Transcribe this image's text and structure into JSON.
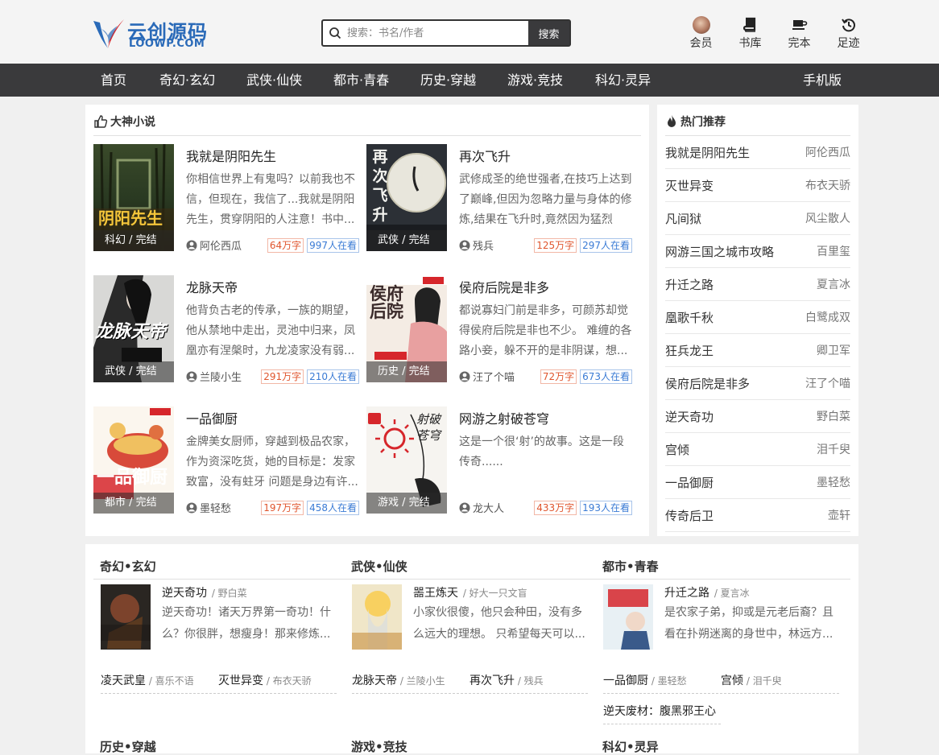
{
  "header": {
    "logo_name": "云创源码",
    "logo_domain": "LOOWP.COM",
    "search_placeholder": "搜索：书名/作者",
    "search_button": "搜索",
    "user_nav": [
      {
        "label": "会员",
        "icon": "avatar"
      },
      {
        "label": "书库",
        "icon": "book-icon"
      },
      {
        "label": "完本",
        "icon": "cup-icon"
      },
      {
        "label": "足迹",
        "icon": "history-icon"
      }
    ]
  },
  "nav": {
    "items": [
      "首页",
      "奇幻·玄幻",
      "武侠·仙侠",
      "都市·青春",
      "历史·穿越",
      "游戏·竞技",
      "科幻·灵异"
    ],
    "mobile": "手机版"
  },
  "featured": {
    "title": "大神小说",
    "books": [
      {
        "title": "我就是阴阳先生",
        "desc": "你相信世界上有鬼吗？以前我也不信，但现在，我信了...我就是阴阳先生，贯穿阴阳的人注意！书中...",
        "tag": "科幻 / 完结",
        "author": "阿伦西瓜",
        "words": "64万字",
        "readers": "997人在看",
        "cover_text": "阴阳先生"
      },
      {
        "title": "再次飞升",
        "desc": "武修成圣的绝世强者,在技巧上达到了巅峰,但因为忽略力量与身体的修炼,结果在飞升时,竟然因为猛烈的...",
        "tag": "武侠 / 完结",
        "author": "残兵",
        "words": "125万字",
        "readers": "297人在看",
        "cover_text": "再次飞升"
      },
      {
        "title": "龙脉天帝",
        "desc": "他背负古老的传承，一族的期望，他从禁地中走出，灵池中归来，凤凰亦有涅槃时，九龙凌家没有弱...",
        "tag": "武侠 / 完结",
        "author": "兰陵小生",
        "words": "291万字",
        "readers": "210人在看",
        "cover_text": "龙脉天帝"
      },
      {
        "title": "侯府后院是非多",
        "desc": "都说寡妇门前是非多，可颜苏却觉得侯府后院是非也不少。 难缠的各路小妾，躲不开的是非阴谋，想...",
        "tag": "历史 / 完结",
        "author": "汪了个喵",
        "words": "72万字",
        "readers": "673人在看",
        "cover_text": "侯府后院"
      },
      {
        "title": "一品御厨",
        "desc": "金牌美女厨师，穿越到极品农家，作为资深吃货，她的目标是：发家致富，没有蛀牙 问题是身边有许...",
        "tag": "都市 / 完结",
        "author": "墨轻愁",
        "words": "197万字",
        "readers": "458人在看",
        "cover_text": "一品御厨"
      },
      {
        "title": "网游之射破苍穹",
        "desc": "这是一个很‘射’的故事。这是一段传奇......",
        "tag": "游戏 / 完结",
        "author": "龙大人",
        "words": "433万字",
        "readers": "193人在看",
        "cover_text": "射破苍穹"
      }
    ]
  },
  "hot": {
    "title": "热门推荐",
    "items": [
      {
        "title": "我就是阴阳先生",
        "author": "阿伦西瓜"
      },
      {
        "title": "灭世异变",
        "author": "布衣天骄"
      },
      {
        "title": "凡间狱",
        "author": "风尘散人"
      },
      {
        "title": "网游三国之城市攻略",
        "author": "百里玺"
      },
      {
        "title": "升迁之路",
        "author": "夏言冰"
      },
      {
        "title": "凰歌千秋",
        "author": "白鹭成双"
      },
      {
        "title": "狂兵龙王",
        "author": "卿卫军"
      },
      {
        "title": "侯府后院是非多",
        "author": "汪了个喵"
      },
      {
        "title": "逆天奇功",
        "author": "野白菜"
      },
      {
        "title": "宫倾",
        "author": "泪千臾"
      },
      {
        "title": "一品御厨",
        "author": "墨轻愁"
      },
      {
        "title": "传奇后卫",
        "author": "壶轩"
      }
    ]
  },
  "categories": [
    {
      "title": "奇幻•玄幻",
      "feature": {
        "title": "逆天奇功",
        "author": "野白菜",
        "desc": "逆天奇功！诸天万界第一奇功！什么？你很胖，想瘦身！那来修炼..."
      },
      "links": [
        {
          "title": "凌天武皇",
          "author": "喜乐不语"
        },
        {
          "title": "灭世异变",
          "author": "布衣天骄"
        }
      ]
    },
    {
      "title": "武侠•仙侠",
      "feature": {
        "title": "噐王炼天",
        "author": "好大一只文盲",
        "desc": "小家伙很傻，他只会种田，没有多么远大的理想。 只希望每天可以..."
      },
      "links": [
        {
          "title": "龙脉天帝",
          "author": "兰陵小生"
        },
        {
          "title": "再次飞升",
          "author": "残兵"
        }
      ]
    },
    {
      "title": "都市•青春",
      "feature": {
        "title": "升迁之路",
        "author": "夏言冰",
        "desc": "是农家子弟，抑或是元老后裔？且看在扑朔迷离的身世中，林远方..."
      },
      "links": [
        {
          "title": "一品御厨",
          "author": "墨轻愁"
        },
        {
          "title": "宫倾",
          "author": "泪千臾"
        },
        {
          "title": "逆天废材：腹黑邪王心",
          "author": ""
        }
      ]
    }
  ],
  "categories_next": [
    "历史•穿越",
    "游戏•竞技",
    "科幻•灵异"
  ],
  "colors": {
    "nav_bg": "#3a3a3c",
    "words": "#e0552d",
    "readers": "#3a7bd5",
    "brand": "#2a6ab8"
  }
}
